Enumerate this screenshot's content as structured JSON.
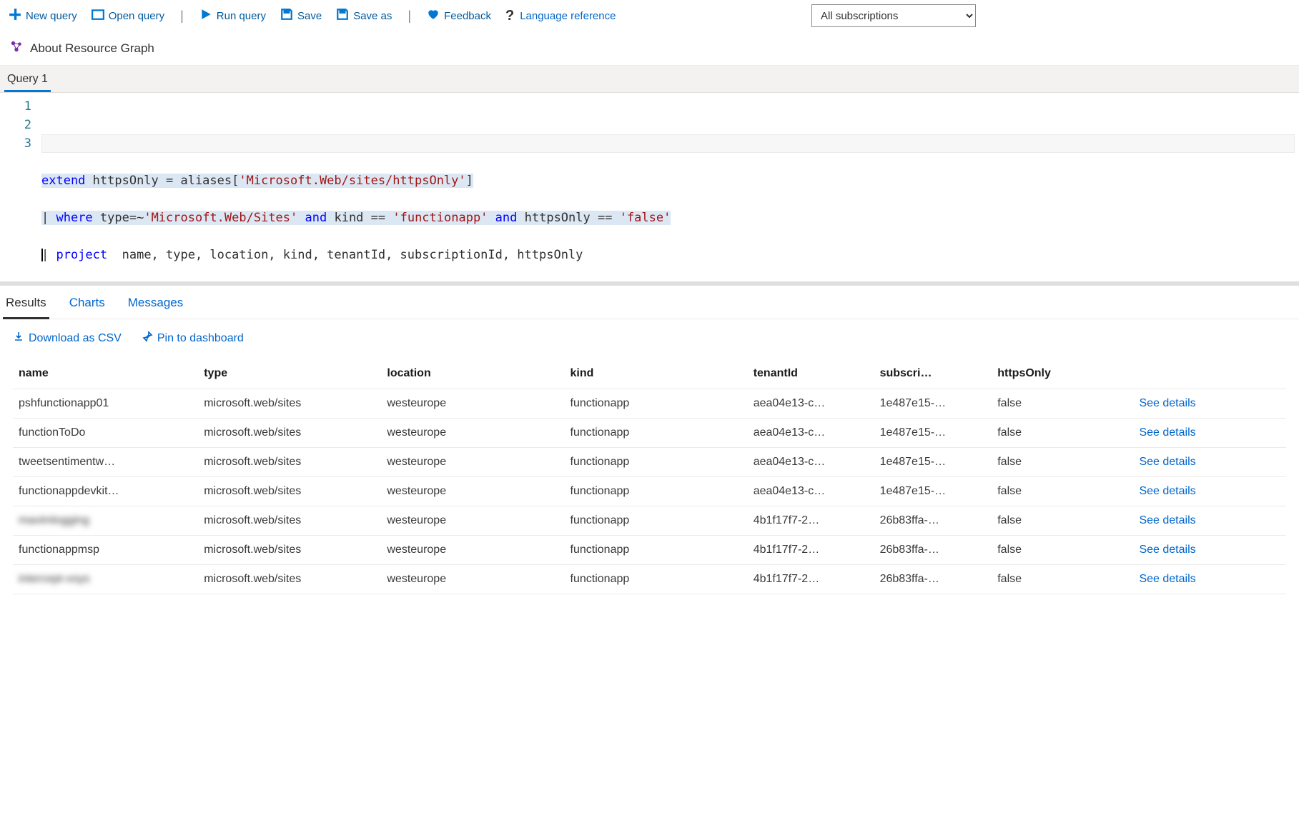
{
  "toolbar": {
    "new_query": "New query",
    "open_query": "Open query",
    "run_query": "Run query",
    "save": "Save",
    "save_as": "Save as",
    "feedback": "Feedback",
    "language_reference": "Language reference"
  },
  "dropdown": {
    "selected": "All subscriptions"
  },
  "about": {
    "label": "About Resource Graph"
  },
  "tabs": {
    "query_tab": "Query 1"
  },
  "editor": {
    "lines": [
      "1",
      "2",
      "3"
    ],
    "code_plain": "extend httpsOnly = aliases['Microsoft.Web/sites/httpsOnly']\n| where type=~'Microsoft.Web/Sites' and kind == 'functionapp' and httpsOnly == 'false'\n| project  name, type, location, kind, tenantId, subscriptionId, httpsOnly"
  },
  "result_tabs": {
    "results": "Results",
    "charts": "Charts",
    "messages": "Messages"
  },
  "result_actions": {
    "download_csv": "Download as CSV",
    "pin_dashboard": "Pin to dashboard"
  },
  "table": {
    "headers": {
      "name": "name",
      "type": "type",
      "location": "location",
      "kind": "kind",
      "tenantId": "tenantId",
      "subscriptionId": "subscri…",
      "httpsOnly": "httpsOnly",
      "details": ""
    },
    "see_details": "See details",
    "rows": [
      {
        "name": "pshfunctionapp01",
        "type": "microsoft.web/sites",
        "location": "westeurope",
        "kind": "functionapp",
        "tenantId": "aea04e13-c…",
        "subscriptionId": "1e487e15-…",
        "httpsOnly": "false",
        "blur": false
      },
      {
        "name": "functionToDo",
        "type": "microsoft.web/sites",
        "location": "westeurope",
        "kind": "functionapp",
        "tenantId": "aea04e13-c…",
        "subscriptionId": "1e487e15-…",
        "httpsOnly": "false",
        "blur": false
      },
      {
        "name": "tweetsentimentw…",
        "type": "microsoft.web/sites",
        "location": "westeurope",
        "kind": "functionapp",
        "tenantId": "aea04e13-c…",
        "subscriptionId": "1e487e15-…",
        "httpsOnly": "false",
        "blur": false
      },
      {
        "name": "functionappdevkit…",
        "type": "microsoft.web/sites",
        "location": "westeurope",
        "kind": "functionapp",
        "tenantId": "aea04e13-c…",
        "subscriptionId": "1e487e15-…",
        "httpsOnly": "false",
        "blur": false
      },
      {
        "name": "mavimlogging",
        "type": "microsoft.web/sites",
        "location": "westeurope",
        "kind": "functionapp",
        "tenantId": "4b1f17f7-2…",
        "subscriptionId": "26b83ffa-…",
        "httpsOnly": "false",
        "blur": true
      },
      {
        "name": "functionappmsp",
        "type": "microsoft.web/sites",
        "location": "westeurope",
        "kind": "functionapp",
        "tenantId": "4b1f17f7-2…",
        "subscriptionId": "26b83ffa-…",
        "httpsOnly": "false",
        "blur": false
      },
      {
        "name": "intercept-voys",
        "type": "microsoft.web/sites",
        "location": "westeurope",
        "kind": "functionapp",
        "tenantId": "4b1f17f7-2…",
        "subscriptionId": "26b83ffa-…",
        "httpsOnly": "false",
        "blur": true
      }
    ]
  }
}
